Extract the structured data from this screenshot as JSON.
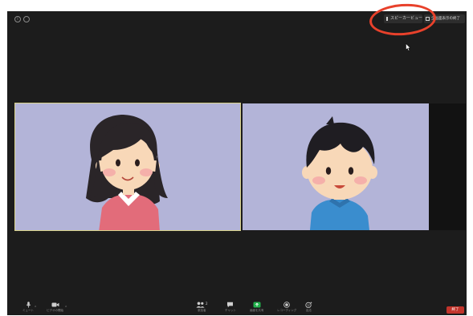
{
  "toolbar_top": {
    "speaker_view": "スピーカービュー",
    "fullscreen": "全画面表示の終了"
  },
  "participants": [
    {
      "name": "woman",
      "active_speaker": true
    },
    {
      "name": "man",
      "active_speaker": false
    }
  ],
  "toolbar": {
    "mute": "ミュート",
    "video": "ビデオの開始",
    "participants": "参加者",
    "participants_count": "2",
    "chat": "チャット",
    "share": "画面を共有",
    "record": "レコーディング",
    "reactions": "反応",
    "end": "終了"
  },
  "colors": {
    "annotation_circle": "#e8412b",
    "end_button": "#c2342b",
    "share_icon": "#22b24c",
    "video_background": "#b3b4d8"
  }
}
